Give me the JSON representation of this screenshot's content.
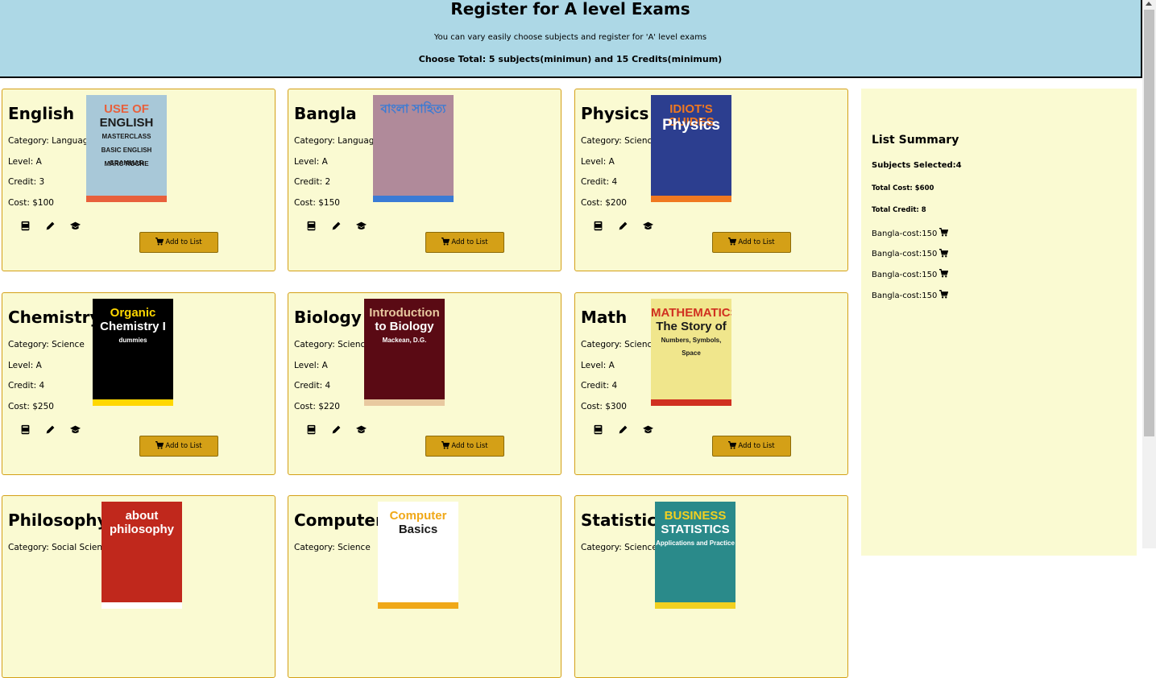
{
  "header": {
    "title": "Register for A level Exams",
    "subtitle": "You can vary easily choose subjects and register for 'A' level exams",
    "requirement": "Choose Total: 5 subjects(minimun) and 15 Credits(minimum)",
    "bg_color": "#add8e6"
  },
  "cards": [
    {
      "name": "English",
      "category": "Category: Language",
      "level": "Level: A",
      "credit": "Credit: 3",
      "cost": "Cost: $100",
      "button": "Add to List",
      "cover": {
        "lines": [
          "USE OF",
          "ENGLISH",
          "MASTERCLASS",
          "BASIC ENGLISH GRAMMAR",
          "MARC ROCHE"
        ],
        "bg": "#a8c8d8",
        "accent": "#e8603c"
      }
    },
    {
      "name": "Bangla",
      "category": "Category: Language",
      "level": "Level: A",
      "credit": "Credit: 2",
      "cost": "Cost: $150",
      "button": "Add to List",
      "cover": {
        "lines": [
          "বাংলা সাহিত্য"
        ],
        "bg": "#b08a9a",
        "accent": "#3a7bd5"
      }
    },
    {
      "name": "Physics",
      "category": "Category: Science",
      "level": "Level: A",
      "credit": "Credit: 4",
      "cost": "Cost: $200",
      "button": "Add to List",
      "cover": {
        "lines": [
          "IDIOT'S GUIDES",
          "Physics"
        ],
        "bg": "#2c3e8f",
        "accent": "#f07820"
      }
    },
    {
      "name": "Chemistry",
      "category": "Category: Science",
      "level": "Level: A",
      "credit": "Credit: 4",
      "cost": "Cost: $250",
      "button": "Add to List",
      "cover": {
        "lines": [
          "Organic",
          "Chemistry I",
          "dummies"
        ],
        "bg": "#000000",
        "accent": "#ffd700"
      }
    },
    {
      "name": "Biology",
      "category": "Category: Science",
      "level": "Level: A",
      "credit": "Credit: 4",
      "cost": "Cost: $220",
      "button": "Add to List",
      "cover": {
        "lines": [
          "Introduction",
          "to Biology",
          "Mackean, D.G."
        ],
        "bg": "#5a0a14",
        "accent": "#e8c9a0"
      }
    },
    {
      "name": "Math",
      "category": "Category: Science",
      "level": "Level: A",
      "credit": "Credit: 4",
      "cost": "Cost: $300",
      "button": "Add to List",
      "cover": {
        "lines": [
          "MATHEMATICS",
          "The Story of",
          "Numbers, Symbols, Space"
        ],
        "bg": "#f0e68c",
        "accent": "#d03020"
      }
    },
    {
      "name": "Philosophy",
      "category": "Category: Social Science",
      "level": "",
      "credit": "",
      "cost": "",
      "button": "",
      "cover": {
        "lines": [
          "about",
          "philosophy"
        ],
        "bg": "#c0281c",
        "accent": "#ffffff"
      }
    },
    {
      "name": "Computer",
      "category": "Category: Science",
      "level": "",
      "credit": "",
      "cost": "",
      "button": "",
      "cover": {
        "lines": [
          "Computer",
          "Basics"
        ],
        "bg": "#ffffff",
        "accent": "#f0a818"
      }
    },
    {
      "name": "Statistics",
      "category": "Category: Science",
      "level": "",
      "credit": "",
      "cost": "",
      "button": "",
      "cover": {
        "lines": [
          "BUSINESS",
          "STATISTICS",
          "Applications and Practice"
        ],
        "bg": "#2a8a8a",
        "accent": "#f2d020"
      }
    }
  ],
  "summary": {
    "title": "List Summary",
    "subjects_selected": "Subjects Selected:4",
    "total_cost": "Total Cost: $600",
    "total_credit": "Total Credit: 8",
    "items": [
      "Bangla-cost:150",
      "Bangla-cost:150",
      "Bangla-cost:150",
      "Bangla-cost:150"
    ]
  },
  "icons": {
    "book": "book-icon",
    "edit": "pencil-icon",
    "grad": "graduation-cap-icon",
    "cart": "cart-icon"
  },
  "colors": {
    "card_bg": "#fafad2",
    "card_border": "#d4a017",
    "button": "#d4a017"
  }
}
